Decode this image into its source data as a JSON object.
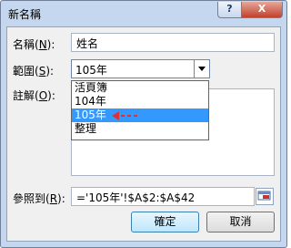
{
  "window": {
    "title": "新名稱",
    "help_label": "?",
    "close_label": "X"
  },
  "form": {
    "name_label": "名稱(",
    "name_key": "N",
    "name_label_end": "):",
    "name_value": "姓名",
    "scope_label": "範圍(",
    "scope_key": "S",
    "scope_label_end": "):",
    "scope_value": "105年",
    "comment_label": "註解(",
    "comment_key": "O",
    "comment_label_end": "):",
    "ref_label": "參照到(",
    "ref_key": "R",
    "ref_label_end": "):",
    "ref_value": "='105年'!$A$2:$A$42"
  },
  "dropdown": {
    "items": [
      "活頁簿",
      "104年",
      "105年",
      "整理"
    ],
    "selected_index": 2,
    "arrow_color": "#e03030"
  },
  "buttons": {
    "ok": "確定",
    "cancel": "取消"
  }
}
